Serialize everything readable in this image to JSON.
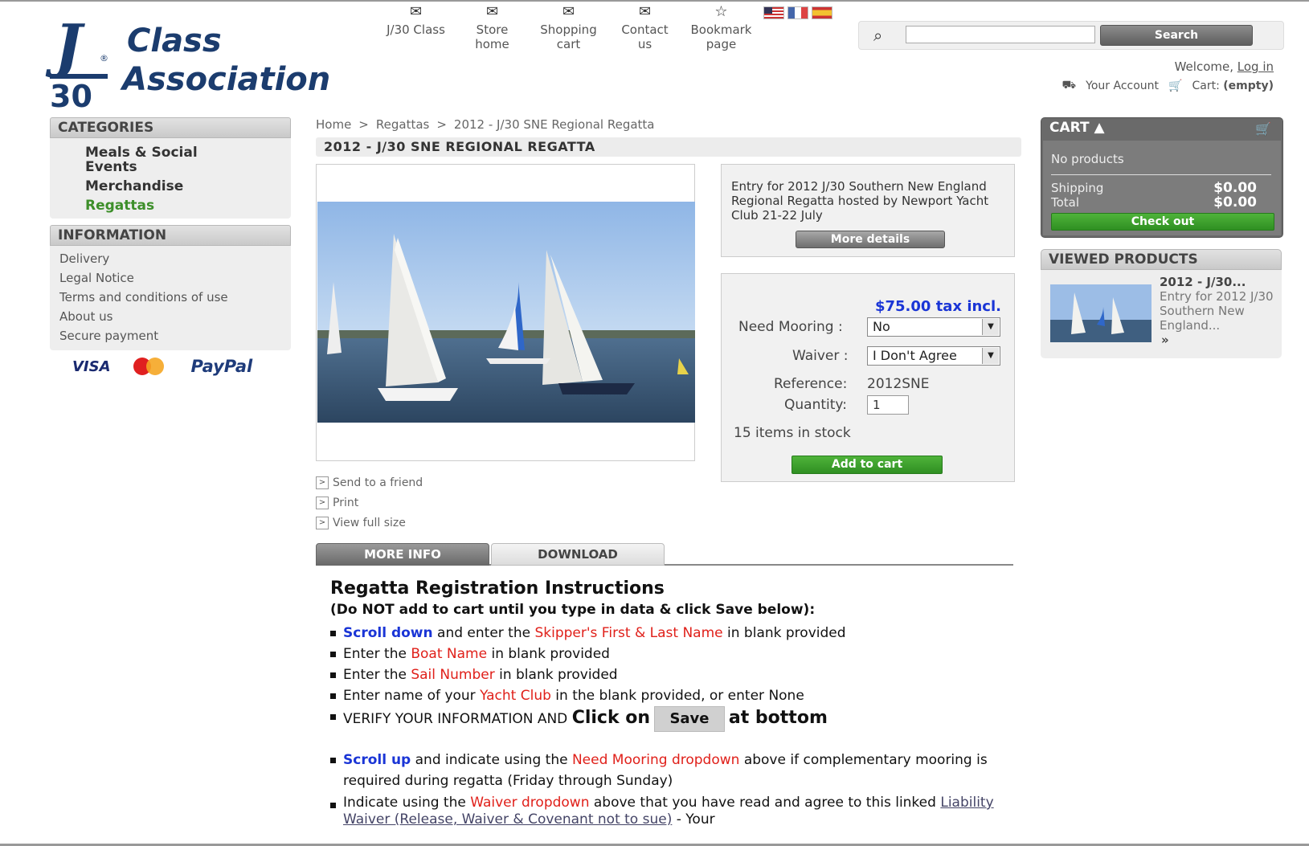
{
  "logo": {
    "j": "J",
    "reg": "®",
    "n30": "30",
    "line1": "Class",
    "line2": "Association"
  },
  "topnav": [
    {
      "line1": "J/30 Class",
      "line2": "",
      "icon": "envelope-icon"
    },
    {
      "line1": "Store",
      "line2": "home",
      "icon": "envelope-icon"
    },
    {
      "line1": "Shopping",
      "line2": "cart",
      "icon": "envelope-icon"
    },
    {
      "line1": "Contact",
      "line2": "us",
      "icon": "envelope-icon"
    },
    {
      "line1": "Bookmark",
      "line2": "page",
      "icon": "star-icon"
    }
  ],
  "search": {
    "button": "Search",
    "value": ""
  },
  "header": {
    "welcome": "Welcome,",
    "login": "Log in",
    "account": "Your Account",
    "cart_label": "Cart:",
    "cart_status": "(empty)"
  },
  "categories": {
    "title": "CATEGORIES",
    "items": [
      "Meals & Social Events",
      "Merchandise",
      "Regattas"
    ]
  },
  "information": {
    "title": "INFORMATION",
    "items": [
      "Delivery",
      "Legal Notice",
      "Terms and conditions of use",
      "About us",
      "Secure payment"
    ]
  },
  "payment": {
    "visa": "VISA",
    "paypal": "PayPal"
  },
  "breadcrumb": {
    "home": "Home",
    "sep": ">",
    "section": "Regattas",
    "current": "2012 - J/30 SNE Regional Regatta"
  },
  "product": {
    "title": "2012 - J/30 SNE REGIONAL REGATTA",
    "short_desc": "Entry for 2012 J/30 Southern New England Regional Regatta hosted by Newport Yacht Club 21-22 July",
    "more_details": "More details",
    "price": "$75.00 tax incl.",
    "mooring_label": "Need Mooring :",
    "mooring_value": "No",
    "waiver_label": "Waiver :",
    "waiver_value": "I Don't Agree",
    "ref_label": "Reference:",
    "ref_value": "2012SNE",
    "qty_label": "Quantity:",
    "qty_value": "1",
    "stock": "15 items in stock",
    "add_to_cart": "Add to cart"
  },
  "links": [
    "Send to a friend",
    "Print",
    "View full size"
  ],
  "tabs": {
    "more_info": "MORE INFO",
    "download": "DOWNLOAD"
  },
  "instructions": {
    "title": "Regatta Registration Instructions",
    "sub": "(Do NOT add to cart until you type in data & click Save below):",
    "b1": {
      "a": "Scroll down",
      "b": " and enter the ",
      "c": "Skipper's First & Last Name",
      "d": " in blank provided"
    },
    "b2": {
      "a": "Enter the ",
      "b": "Boat Name",
      "c": " in blank provided"
    },
    "b3": {
      "a": "Enter the ",
      "b": "Sail Number",
      "c": " in blank provided"
    },
    "b4": {
      "a": "Enter name of your ",
      "b": "Yacht Club",
      "c": " in the blank provided, or enter None"
    },
    "b5": {
      "a": "VERIFY YOUR INFORMATION AND ",
      "b": "Click on",
      "c": "Save",
      "d": "at bottom"
    },
    "b6": {
      "a": "Scroll up",
      "b": " and indicate using the ",
      "c": "Need Mooring dropdown",
      "d": " above if complementary mooring is required during regatta (Friday through Sunday)"
    },
    "b7": {
      "a": "Indicate using the ",
      "b": "Waiver dropdown",
      "c": " above that you have read and agree to this linked ",
      "d": "Liability Waiver (Release, Waiver & Covenant not to sue)",
      "e": " - Your"
    }
  },
  "cart": {
    "title": "CART",
    "no_products": "No products",
    "shipping_label": "Shipping",
    "shipping_value": "$0.00",
    "total_label": "Total",
    "total_value": "$0.00",
    "checkout": "Check out"
  },
  "viewed": {
    "title": "VIEWED PRODUCTS",
    "name": "2012 - J/30...",
    "desc": "Entry for 2012 J/30 Southern New England...",
    "more": "»"
  },
  "colors": {
    "navy": "#1b3c6e",
    "green": "#3d8f2a",
    "price_blue": "#1a35d6",
    "red": "#e0201a"
  }
}
